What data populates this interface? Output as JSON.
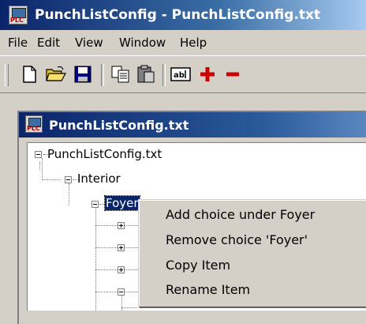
{
  "window": {
    "title": "PunchListConfig - PunchListConfig.txt",
    "icon": "plc-app-icon",
    "icon_text": "PLC"
  },
  "menu": {
    "items": [
      "File",
      "Edit",
      "View",
      "Window",
      "Help"
    ]
  },
  "toolbar": {
    "buttons": [
      {
        "name": "new-document-icon"
      },
      {
        "name": "open-folder-icon"
      },
      {
        "name": "save-disk-icon"
      },
      {
        "name": "copy-icon"
      },
      {
        "name": "paste-icon"
      },
      {
        "name": "rename-field-icon",
        "text": "ab|"
      },
      {
        "name": "add-plus-icon",
        "text": "+",
        "color": "#cc0000"
      },
      {
        "name": "remove-minus-icon",
        "text": "−",
        "color": "#cc0000"
      }
    ]
  },
  "document": {
    "title": "PunchListConfig.txt"
  },
  "tree": {
    "root": "PunchListConfig.txt",
    "child": "Interior",
    "selected": "Foyer",
    "collapsed_children": 3,
    "expanded_children": 1
  },
  "context_menu": {
    "items": [
      "Add choice under Foyer",
      "Remove choice 'Foyer'",
      "Copy Item",
      "Rename Item"
    ]
  },
  "colors": {
    "titlebar": "#0a246a",
    "selection": "#0a246a",
    "toolbar_red": "#cc0000"
  }
}
